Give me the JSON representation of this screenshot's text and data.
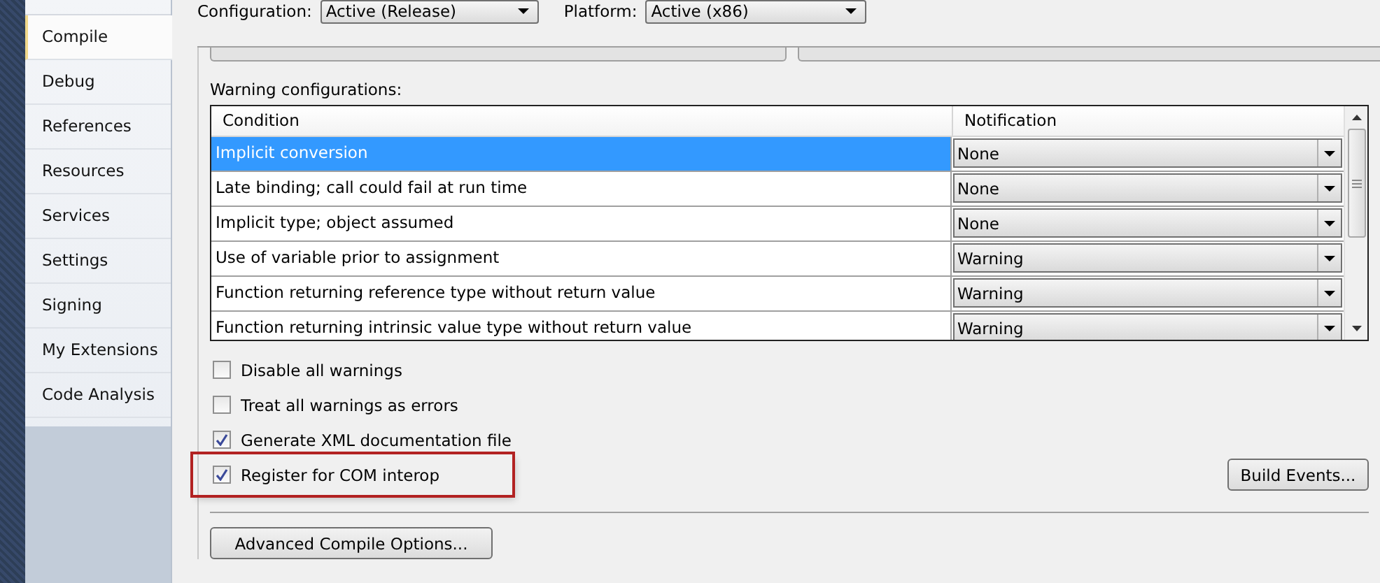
{
  "sidebar": {
    "items": [
      {
        "label": "Compile",
        "selected": true
      },
      {
        "label": "Debug",
        "selected": false
      },
      {
        "label": "References",
        "selected": false
      },
      {
        "label": "Resources",
        "selected": false
      },
      {
        "label": "Services",
        "selected": false
      },
      {
        "label": "Settings",
        "selected": false
      },
      {
        "label": "Signing",
        "selected": false
      },
      {
        "label": "My Extensions",
        "selected": false
      },
      {
        "label": "Code Analysis",
        "selected": false
      }
    ]
  },
  "configuration": {
    "label": "Configuration:",
    "value": "Active (Release)"
  },
  "platform": {
    "label": "Platform:",
    "value": "Active (x86)"
  },
  "warnings": {
    "title": "Warning configurations:",
    "columns": [
      "Condition",
      "Notification"
    ],
    "rows": [
      {
        "condition": "Implicit conversion",
        "notification": "None",
        "selected": true
      },
      {
        "condition": "Late binding; call could fail at run time",
        "notification": "None",
        "selected": false
      },
      {
        "condition": "Implicit type; object assumed",
        "notification": "None",
        "selected": false
      },
      {
        "condition": "Use of variable prior to assignment",
        "notification": "Warning",
        "selected": false
      },
      {
        "condition": "Function returning reference type without return value",
        "notification": "Warning",
        "selected": false
      },
      {
        "condition": "Function returning intrinsic value type without return value",
        "notification": "Warning",
        "selected": false
      }
    ]
  },
  "options": [
    {
      "label": "Disable all warnings",
      "checked": false,
      "highlighted": false
    },
    {
      "label": "Treat all warnings as errors",
      "checked": false,
      "highlighted": false
    },
    {
      "label": "Generate XML documentation file",
      "checked": true,
      "highlighted": false
    },
    {
      "label": "Register for COM interop",
      "checked": true,
      "highlighted": true
    }
  ],
  "build_events_button": "Build Events...",
  "advanced_button": "Advanced Compile Options..."
}
